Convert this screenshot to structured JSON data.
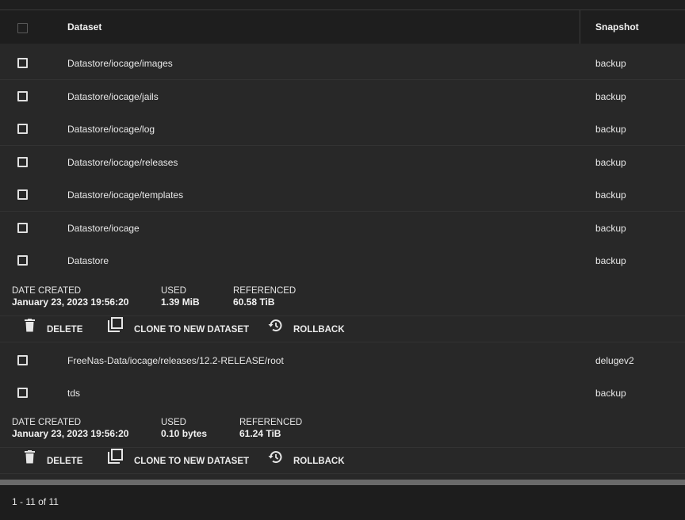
{
  "table": {
    "header": {
      "dataset": "Dataset",
      "snapshot": "Snapshot"
    },
    "rows": [
      {
        "dataset": "Datastore/iocage/images",
        "snapshot": "backup"
      },
      {
        "dataset": "Datastore/iocage/jails",
        "snapshot": "backup"
      },
      {
        "dataset": "Datastore/iocage/log",
        "snapshot": "backup"
      },
      {
        "dataset": "Datastore/iocage/releases",
        "snapshot": "backup"
      },
      {
        "dataset": "Datastore/iocage/templates",
        "snapshot": "backup"
      },
      {
        "dataset": "Datastore/iocage",
        "snapshot": "backup"
      },
      {
        "dataset": "Datastore",
        "snapshot": "backup"
      },
      {
        "dataset": "FreeNas-Data/iocage/releases/12.2-RELEASE/root",
        "snapshot": "delugev2"
      },
      {
        "dataset": "tds",
        "snapshot": "backup"
      }
    ],
    "details": [
      {
        "date_label": "DATE CREATED",
        "date_value": "January 23, 2023 19:56:20",
        "used_label": "USED",
        "used_value": "1.39 MiB",
        "ref_label": "REFERENCED",
        "ref_value": "60.58 TiB"
      },
      {
        "date_label": "DATE CREATED",
        "date_value": "January 23, 2023 19:56:20",
        "used_label": "USED",
        "used_value": "0.10 bytes",
        "ref_label": "REFERENCED",
        "ref_value": "61.24 TiB"
      }
    ],
    "actions": {
      "delete": "DELETE",
      "clone": "CLONE TO NEW DATASET",
      "rollback": "ROLLBACK"
    }
  },
  "footer": {
    "pagination": "1 - 11 of 11"
  },
  "icons": {
    "delete": "trash-icon",
    "clone": "copy-icon",
    "rollback": "history-icon"
  },
  "colors": {
    "background": "#282828",
    "header": "#1e1e1e",
    "footer": "#1d1d1d",
    "text": "#e6e6e6"
  }
}
